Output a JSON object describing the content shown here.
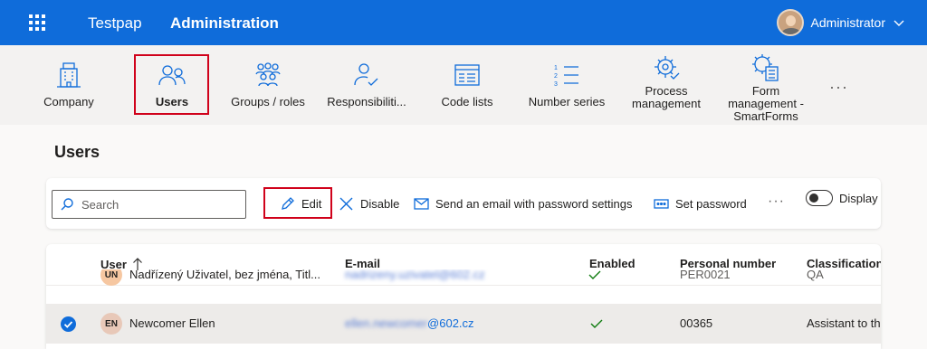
{
  "header": {
    "app_name": "Testpap",
    "section_name": "Administration",
    "user_name": "Administrator"
  },
  "modules": [
    {
      "label": "Company",
      "icon": "building-icon"
    },
    {
      "label": "Users",
      "icon": "users-icon",
      "selected": true
    },
    {
      "label": "Groups / roles",
      "icon": "groups-icon"
    },
    {
      "label": "Responsibiliti...",
      "icon": "person-check-icon"
    },
    {
      "label": "Code lists",
      "icon": "code-list-icon"
    },
    {
      "label": "Number series",
      "icon": "number-list-icon"
    },
    {
      "label": "Process management",
      "icon": "process-gear-icon"
    },
    {
      "label": "Form management - SmartForms",
      "icon": "form-gear-icon"
    }
  ],
  "page": {
    "title": "Users"
  },
  "toolbar": {
    "search_placeholder": "Search",
    "edit_label": "Edit",
    "disable_label": "Disable",
    "send_email_label": "Send an email with password settings",
    "set_password_label": "Set password",
    "toggle_label": "Display technical"
  },
  "grid": {
    "columns": {
      "user": "User",
      "email": "E-mail",
      "enabled": "Enabled",
      "personal_number": "Personal number",
      "classification": "Classification"
    },
    "sort": {
      "column": "User",
      "direction": "ascending"
    },
    "rows": [
      {
        "initials": "UN",
        "name": "Nadřízený Uživatel, bez jména, Titl...",
        "email": "nadrizeny.uzivatel@602.cz",
        "enabled": true,
        "personal_number": "PER0021",
        "classification": "QA",
        "selected": false,
        "avatar_color": "#f6c7a1"
      },
      {
        "initials": "EN",
        "name": "Newcomer Ellen",
        "email_hidden_part": "ellen.newcomer",
        "email_visible_part": "@602.cz",
        "enabled": true,
        "personal_number": "00365",
        "classification": "Assistant to the",
        "selected": true,
        "avatar_color": "#e8c8b8"
      }
    ]
  },
  "colors": {
    "accent": "#0f6cda",
    "highlight_border": "#d0021b",
    "enabled_check": "#107c10"
  }
}
